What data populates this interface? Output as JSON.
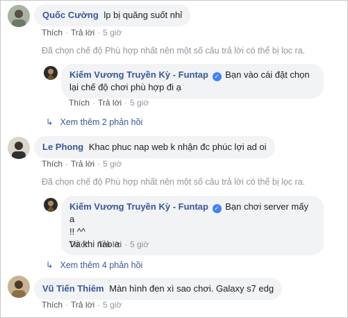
{
  "c1": {
    "name": "Quốc Cường",
    "text": "lp bị quăng suốt nhỉ",
    "like": "Thích",
    "reply": "Trả lời",
    "time": "5 giờ"
  },
  "note1": "Đã chọn chế độ Phù hợp nhất nên một số câu trả lời có thể bị lọc ra.",
  "r1": {
    "name": "Kiếm Vương Truyền Kỳ - Funtap",
    "line1": "Bạn vào cái đặt chọn",
    "line2": "lại chế độ chơi phù hợp đi ạ",
    "like": "Thích",
    "reply": "Trả lời",
    "time": "5 giờ"
  },
  "more1": "Xem thêm 2 phản hồi",
  "c2": {
    "name": "Le Phong",
    "text": "Khac phuc nap web k nhận đc phúc lợi ad oi",
    "like": "Thích",
    "reply": "Trả lời",
    "time": "5 giờ"
  },
  "note2": "Đã chọn chế độ Phù hợp nhất nên một số câu trả lời có thể bị lọc ra.",
  "r2": {
    "name": "Kiếm Vương Truyền Kỳ - Funtap",
    "line1": "Bạn chơi server mấy a",
    "line2": "!! ^^",
    "line3": "Và khi nào a",
    "like": "Thích",
    "reply": "Trả lời",
    "time": "5 giờ"
  },
  "more2": "Xem thêm 4 phản hồi",
  "c3": {
    "name": "Vũ Tiến Thiêm",
    "text": "Màn hình đen xì sao chơi. Galaxy s7 edg",
    "like": "Thích",
    "reply": "Trả lời",
    "time": "5 giờ"
  },
  "colors": {
    "name": "#385898",
    "bubble": "#f2f3f5",
    "meta": "#90949c"
  }
}
